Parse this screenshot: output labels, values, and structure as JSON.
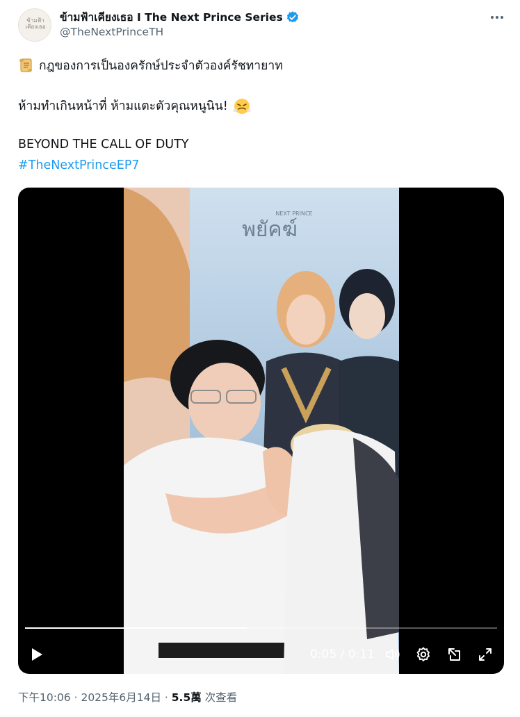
{
  "author": {
    "display_name": "ข้ามฟ้าเคียงเธอ I The Next Prince Series",
    "handle": "@TheNextPrinceTH",
    "avatar_logo_text": "ข้ามฟ้า เคียงเธอ",
    "verified": true,
    "verified_color": "#1d9bf0"
  },
  "tweet": {
    "line1_emoji": "scroll-icon",
    "line1": "กฎของการเป็นองครักษ์ประจำตัวองค์รัชทายาท",
    "line2": "ห้ามทำเกินหน้าที่ ห้ามแตะตัวคุณหนูนิน!",
    "line2_emoji": "huffing-face-icon",
    "line3": "BEYOND THE CALL OF DUTY",
    "hashtag": "#TheNextPrinceEP7"
  },
  "video": {
    "time_display": "0:05 / 0:11",
    "progress_fraction": 0.47,
    "poster_title": "พยัคฆ์",
    "poster_subtitle": "NEXT PRINCE"
  },
  "meta": {
    "time": "下午10:06",
    "separator": " · ",
    "date": "2025年6月14日",
    "views_count": "5.5萬",
    "views_label": " 次查看"
  },
  "colors": {
    "link": "#1d9bf0",
    "secondary_text": "#536471",
    "primary_text": "#0f1419"
  }
}
